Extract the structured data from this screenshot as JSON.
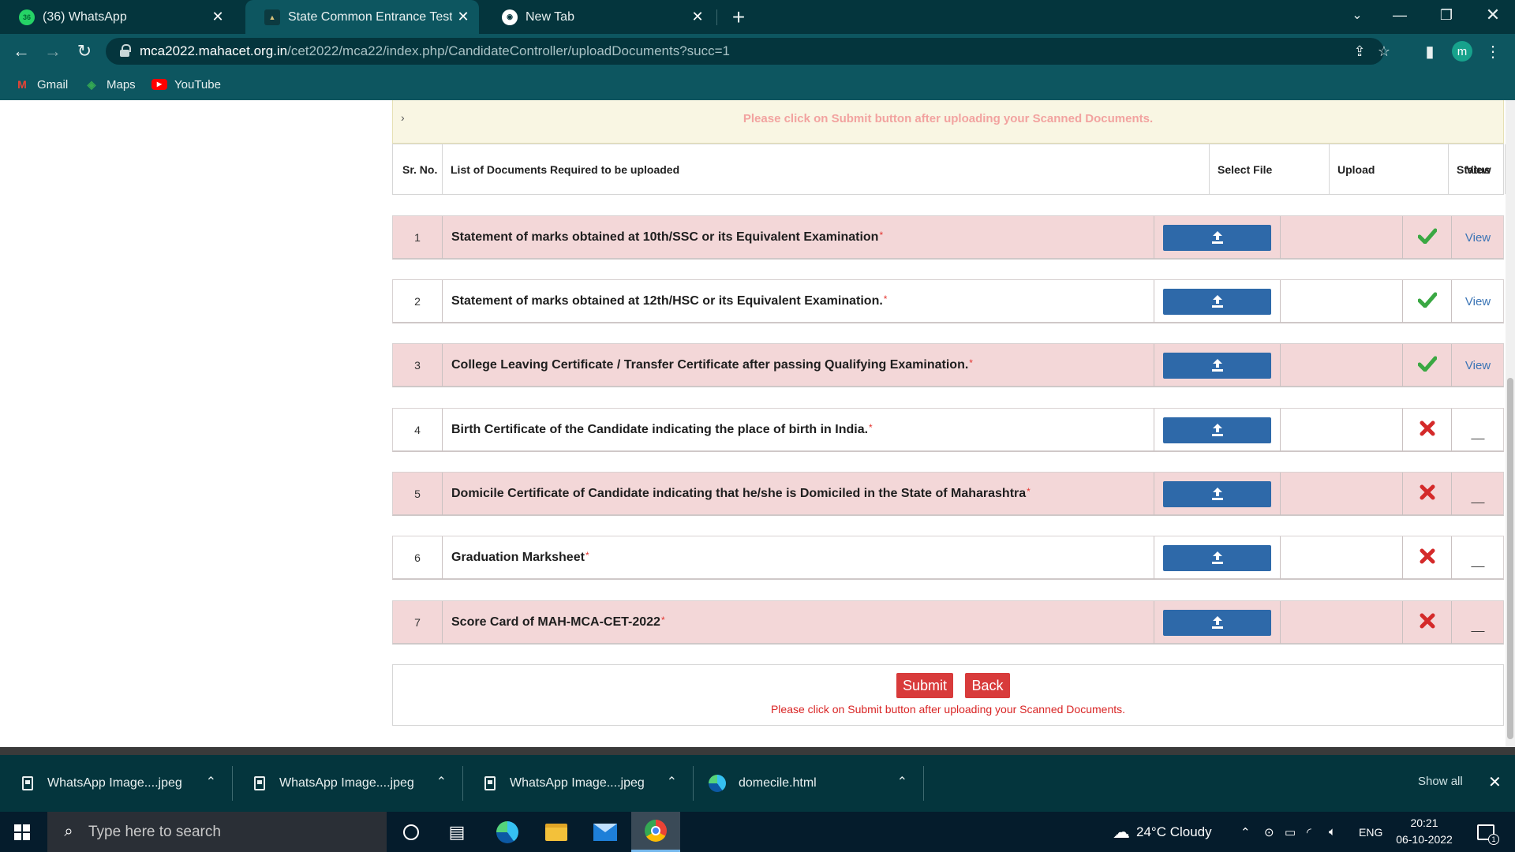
{
  "browser": {
    "tabs": [
      {
        "title": "(36) WhatsApp",
        "active": false,
        "badge": "36"
      },
      {
        "title": "State Common Entrance Test Cell",
        "active": true
      },
      {
        "title": "New Tab",
        "active": false
      }
    ],
    "url_host": "mca2022.mahacet.org.in",
    "url_path": "/cet2022/mca22/index.php/CandidateController/uploadDocuments?succ=1",
    "avatar_letter": "m",
    "bookmarks": [
      "Gmail",
      "Maps",
      "YouTube"
    ]
  },
  "page": {
    "notice": "Please click on Submit button after uploading your Scanned Documents.",
    "table": {
      "headers": {
        "sr_no": "Sr. No.",
        "documents": "List of Documents Required to be uploaded",
        "select_file": "Select File",
        "upload": "Upload",
        "status": "Status",
        "view": "View"
      },
      "rows": [
        {
          "no": "1",
          "doc": "Statement of marks obtained at 10th/SSC or its Equivalent Examination",
          "status": "uploaded",
          "view": "View"
        },
        {
          "no": "2",
          "doc": "Statement of marks obtained at 12th/HSC or its Equivalent Examination.",
          "status": "uploaded",
          "view": "View"
        },
        {
          "no": "3",
          "doc": "College Leaving Certificate / Transfer Certificate after passing Qualifying Examination.",
          "status": "uploaded",
          "view": "View"
        },
        {
          "no": "4",
          "doc": "Birth Certificate of the Candidate indicating the place of birth in India.",
          "status": "missing",
          "view": "__"
        },
        {
          "no": "5",
          "doc": "Domicile Certificate of Candidate indicating that he/she is Domiciled in the State of Maharashtra",
          "status": "missing",
          "view": "__"
        },
        {
          "no": "6",
          "doc": "Graduation Marksheet",
          "status": "missing",
          "view": "__"
        },
        {
          "no": "7",
          "doc": "Score Card of MAH-MCA-CET-2022",
          "status": "missing",
          "view": "__"
        }
      ],
      "required_mark": "*"
    },
    "submit_label": "Submit",
    "back_label": "Back",
    "footer_note": "Please click on Submit button after uploading your Scanned Documents."
  },
  "downloads": {
    "items": [
      "WhatsApp Image....jpeg",
      "WhatsApp Image....jpeg",
      "WhatsApp Image....jpeg",
      "domecile.html"
    ],
    "show_all": "Show all"
  },
  "taskbar": {
    "search_placeholder": "Type here to search",
    "weather": "24°C  Cloudy",
    "language": "ENG",
    "time": "20:21",
    "date": "06-10-2022",
    "notifications": "1"
  },
  "colors": {
    "accent_blue": "#2e69a9",
    "row_pink": "#f3d7d8",
    "check_green": "#3aa843",
    "cross_red": "#d42a2a",
    "button_red": "#d83b3b"
  }
}
